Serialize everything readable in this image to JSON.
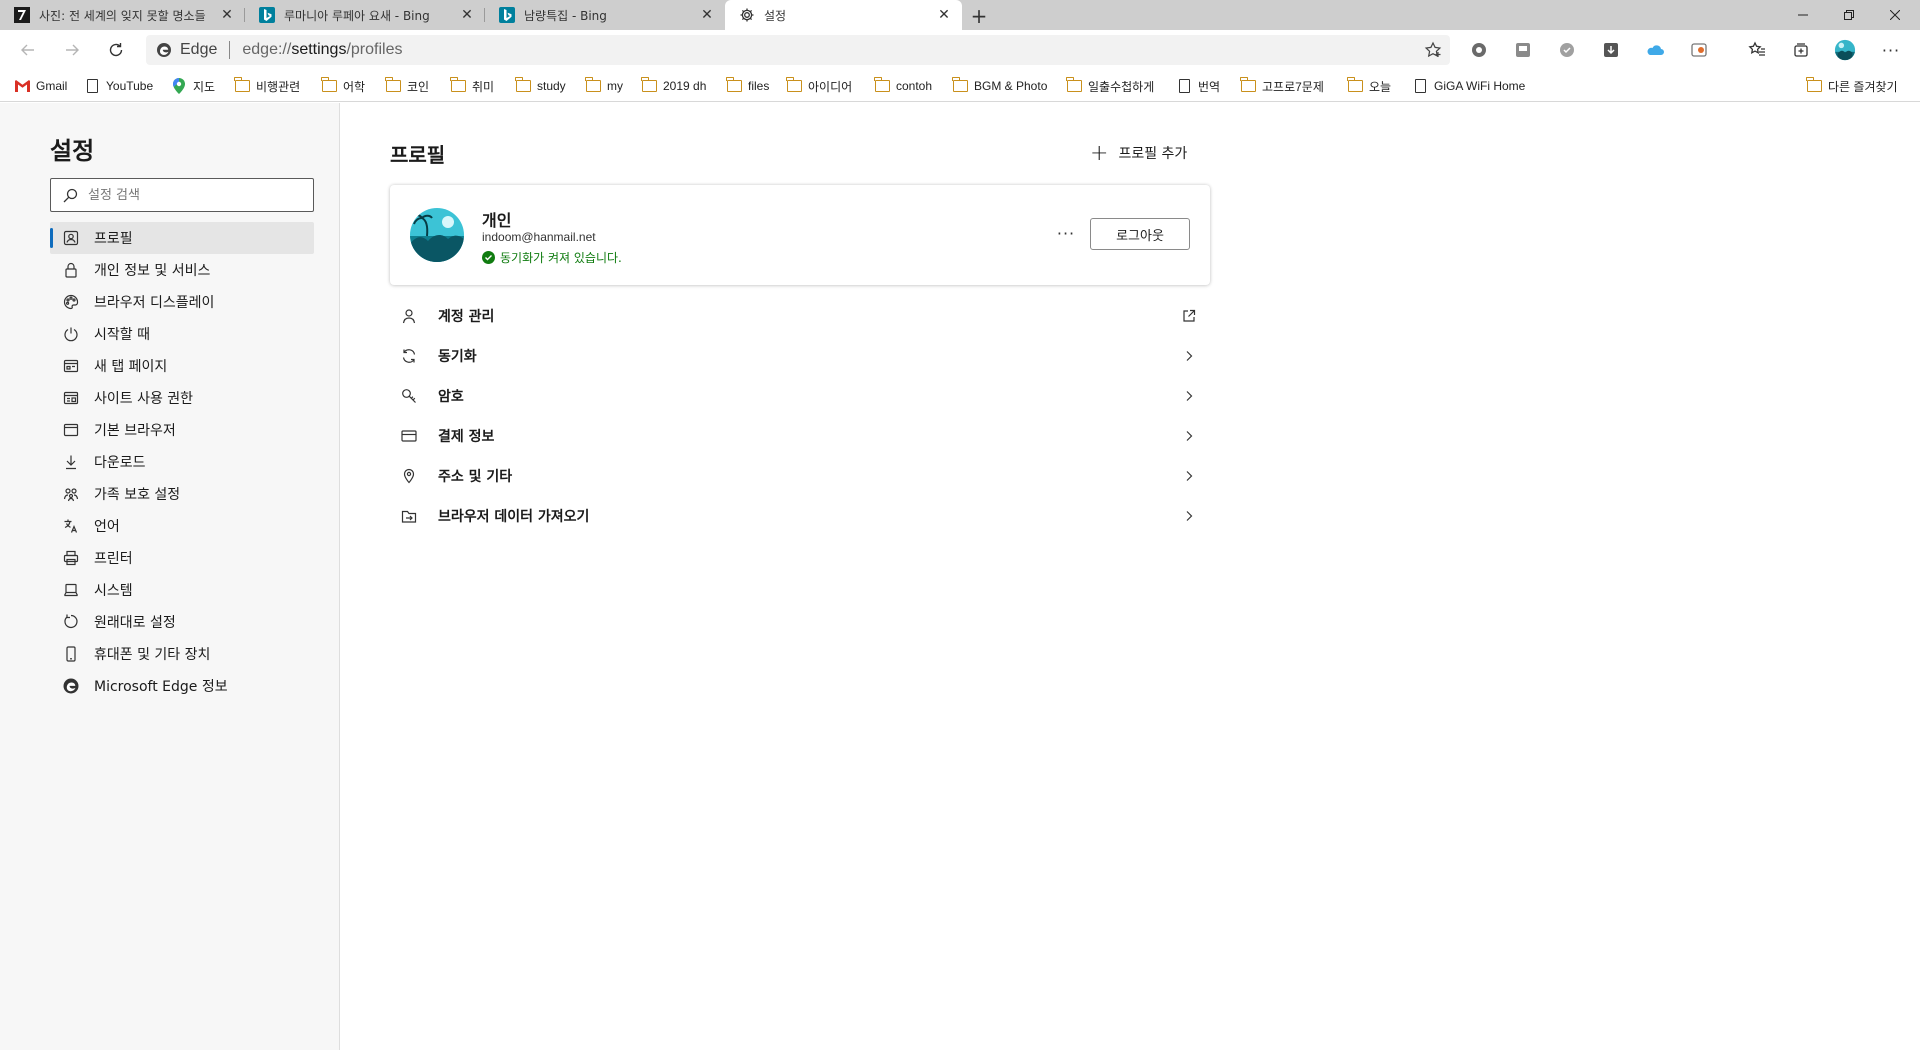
{
  "tabs": [
    {
      "title": "사진: 전 세계의 잊지 못할 명소들",
      "favicon": "photo-site-favicon"
    },
    {
      "title": "루마니아 루페아 요새 - Bing",
      "favicon": "bing-favicon"
    },
    {
      "title": "남량특집 - Bing",
      "favicon": "bing-favicon"
    },
    {
      "title": "설정",
      "favicon": "gear-icon",
      "active": true
    }
  ],
  "address": {
    "label": "Edge",
    "url_prefix": "edge://",
    "url_main": "settings",
    "url_rest": "/profiles"
  },
  "bookmarks": [
    {
      "label": "Gmail",
      "icon": "gmail-icon"
    },
    {
      "label": "YouTube",
      "icon": "page-icon"
    },
    {
      "label": "지도",
      "icon": "maps-pin-icon"
    },
    {
      "label": "비행관련",
      "icon": "folder-icon"
    },
    {
      "label": "어학",
      "icon": "folder-icon"
    },
    {
      "label": "코인",
      "icon": "folder-icon"
    },
    {
      "label": "취미",
      "icon": "folder-icon"
    },
    {
      "label": "study",
      "icon": "folder-icon"
    },
    {
      "label": "my",
      "icon": "folder-icon"
    },
    {
      "label": "2019 dh",
      "icon": "folder-icon"
    },
    {
      "label": "files",
      "icon": "folder-icon"
    },
    {
      "label": "아이디어",
      "icon": "folder-icon"
    },
    {
      "label": "contoh",
      "icon": "folder-icon"
    },
    {
      "label": "BGM & Photo",
      "icon": "folder-icon"
    },
    {
      "label": "일출수첩하게",
      "icon": "folder-icon"
    },
    {
      "label": "번역",
      "icon": "page-icon"
    },
    {
      "label": "고프로7문제",
      "icon": "folder-icon"
    },
    {
      "label": "오늘",
      "icon": "folder-icon"
    },
    {
      "label": "GiGA WiFi Home",
      "icon": "page-icon"
    }
  ],
  "other_favorites": "다른 즐겨찾기",
  "sidebar": {
    "title": "설정",
    "search_placeholder": "설정 검색",
    "items": [
      {
        "label": "프로필",
        "icon": "profile-icon",
        "selected": true
      },
      {
        "label": "개인 정보 및 서비스",
        "icon": "lock-icon"
      },
      {
        "label": "브라우저 디스플레이",
        "icon": "palette-icon"
      },
      {
        "label": "시작할 때",
        "icon": "power-icon"
      },
      {
        "label": "새 탭 페이지",
        "icon": "new-tab-icon"
      },
      {
        "label": "사이트 사용 권한",
        "icon": "site-permissions-icon"
      },
      {
        "label": "기본 브라우저",
        "icon": "browser-icon"
      },
      {
        "label": "다운로드",
        "icon": "download-icon"
      },
      {
        "label": "가족 보호 설정",
        "icon": "family-icon"
      },
      {
        "label": "언어",
        "icon": "language-icon"
      },
      {
        "label": "프린터",
        "icon": "printer-icon"
      },
      {
        "label": "시스템",
        "icon": "system-icon"
      },
      {
        "label": "원래대로 설정",
        "icon": "reset-icon"
      },
      {
        "label": "휴대폰 및 기타 장치",
        "icon": "phone-icon"
      },
      {
        "label": "Microsoft Edge 정보",
        "icon": "edge-logo-icon"
      }
    ]
  },
  "main": {
    "title": "프로필",
    "add_profile": "프로필 추가",
    "profile": {
      "name": "개인",
      "email": "indoom@hanmail.net",
      "sync_status": "동기화가 켜져 있습니다.",
      "logout_label": "로그아웃",
      "more_label": "···"
    },
    "rows": [
      {
        "label": "계정 관리",
        "icon": "person-icon",
        "trailing": "external-link-icon"
      },
      {
        "label": "동기화",
        "icon": "sync-icon",
        "trailing": "chevron-right-icon"
      },
      {
        "label": "암호",
        "icon": "key-icon",
        "trailing": "chevron-right-icon"
      },
      {
        "label": "결제 정보",
        "icon": "card-icon",
        "trailing": "chevron-right-icon"
      },
      {
        "label": "주소 및 기타",
        "icon": "location-icon",
        "trailing": "chevron-right-icon"
      },
      {
        "label": "브라우저 데이터 가져오기",
        "icon": "import-icon",
        "trailing": "chevron-right-icon"
      }
    ]
  },
  "colors": {
    "accent": "#0f6cbd",
    "sync_green": "#107c10",
    "folder": "#c9901c",
    "tabstrip": "#cecece"
  }
}
